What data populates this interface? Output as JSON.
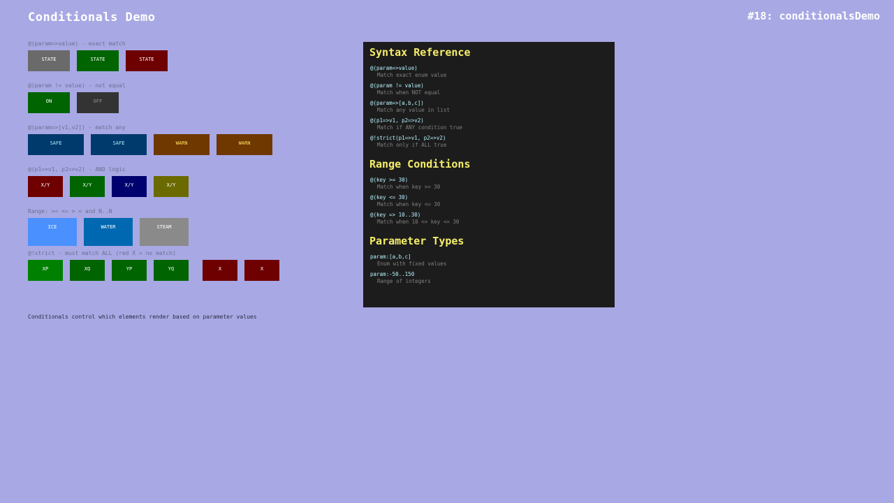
{
  "header": {
    "title": "Conditionals Demo",
    "demo_tag": "#18: conditionalsDemo"
  },
  "sections": [
    {
      "label": "@(param=>value) - exact match",
      "boxes": [
        {
          "text": "STATE",
          "bg": "#6a6a6a",
          "fg": "#ffffff"
        },
        {
          "text": "STATE",
          "bg": "#006400",
          "fg": "#ffffff"
        },
        {
          "text": "STATE",
          "bg": "#6e0000",
          "fg": "#ffffff"
        }
      ]
    },
    {
      "label": "@(param != value) - not equal",
      "boxes": [
        {
          "text": "ON",
          "bg": "#006400",
          "fg": "#ffffff"
        },
        {
          "text": "OFF",
          "bg": "#333333",
          "fg": "#909090"
        }
      ]
    },
    {
      "label": "@(param=>[v1,v2]) - match any",
      "boxes": [
        {
          "text": "SAFE",
          "bg": "#003a6c",
          "fg": "#a8f0ff"
        },
        {
          "text": "SAFE",
          "bg": "#003a6c",
          "fg": "#a8f0ff"
        },
        {
          "text": "WARN",
          "bg": "#6e3800",
          "fg": "#ffe060"
        },
        {
          "text": "WARN",
          "bg": "#6e3800",
          "fg": "#ffe060"
        }
      ]
    },
    {
      "label": "@(p1=>v1, p2=>v2) - AND logic",
      "boxes": [
        {
          "text": "X/Y",
          "bg": "#6e0000",
          "fg": "#ffffff"
        },
        {
          "text": "X/Y",
          "bg": "#006400",
          "fg": "#ffffff"
        },
        {
          "text": "X/Y",
          "bg": "#00006e",
          "fg": "#ffffff"
        },
        {
          "text": "X/Y",
          "bg": "#6a6a00",
          "fg": "#ffffff"
        }
      ]
    },
    {
      "label": "Range: >= <= > < and N..N",
      "boxes": [
        {
          "text": "ICE",
          "bg": "#4a90ff",
          "fg": "#ffffff"
        },
        {
          "text": "WATER",
          "bg": "#0068b0",
          "fg": "#ffffff"
        },
        {
          "text": "STEAM",
          "bg": "#8a8a8a",
          "fg": "#ffffff"
        }
      ]
    },
    {
      "label": "@!strict - must match ALL (red X = no match)",
      "boxes": [
        {
          "text": "XP",
          "bg": "#008000",
          "fg": "#ffffff"
        },
        {
          "text": "XQ",
          "bg": "#006400",
          "fg": "#ffffff"
        },
        {
          "text": "YP",
          "bg": "#006400",
          "fg": "#ffffff"
        },
        {
          "text": "YQ",
          "bg": "#006400",
          "fg": "#ffffff"
        },
        {
          "text": "X",
          "bg": "#6e0000",
          "fg": "#ffffff"
        },
        {
          "text": "X",
          "bg": "#6e0000",
          "fg": "#ffffff"
        }
      ]
    }
  ],
  "footer": "Conditionals control which elements render based on parameter values",
  "reference": {
    "syntax_heading": "Syntax Reference",
    "syntax": [
      {
        "code": "@(param=>value)",
        "desc": "Match exact enum value"
      },
      {
        "code": "@(param != value)",
        "desc": "Match when NOT equal"
      },
      {
        "code": "@(param=>[a,b,c])",
        "desc": "Match any value in list"
      },
      {
        "code": "@(p1=>v1, p2=>v2)",
        "desc": "Match if ANY condition true"
      },
      {
        "code": "@!strict(p1=>v1, p2=>v2)",
        "desc": "Match only if ALL true"
      }
    ],
    "range_heading": "Range Conditions",
    "range": [
      {
        "code": "@(key >= 30)",
        "desc": "Match when key >= 30"
      },
      {
        "code": "@(key <= 30)",
        "desc": "Match when key <= 30"
      },
      {
        "code": "@(key => 10..30)",
        "desc": "Match when 10 <= key <= 30"
      }
    ],
    "param_heading": "Parameter Types",
    "params": [
      {
        "code": "param:[a,b,c]",
        "desc": "Enum with fixed values"
      },
      {
        "code": "param:-50..150",
        "desc": "Range of integers"
      }
    ]
  }
}
